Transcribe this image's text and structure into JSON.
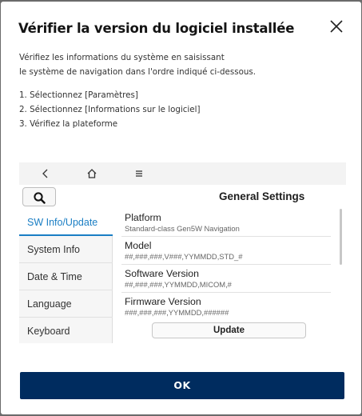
{
  "dialog": {
    "title": "Vérifier la version du logiciel installée",
    "description": [
      "Vérifiez les informations du système en saisissant",
      "le système de navigation dans l'ordre indiqué ci-dessous."
    ],
    "steps": [
      "1. Sélectionnez [Paramètres]",
      "2. Sélectionnez [Informations sur le logiciel]",
      "3. Vérifiez la plateforme"
    ],
    "ok_label": "OK",
    "close_icon": "close-icon"
  },
  "device_screen": {
    "top_icons": [
      "back-arrow-icon",
      "home-icon",
      "menu-icon"
    ],
    "search_icon": "search-icon",
    "title": "General Settings",
    "sidebar": [
      {
        "label": "SW Info/Update",
        "active": true
      },
      {
        "label": "System Info",
        "active": false
      },
      {
        "label": "Date & Time",
        "active": false
      },
      {
        "label": "Language",
        "active": false
      },
      {
        "label": "Keyboard",
        "active": false
      }
    ],
    "details": [
      {
        "label": "Platform",
        "value": "Standard-class Gen5W Navigation"
      },
      {
        "label": "Model",
        "value": "##,###,###,V###,YYMMDD,STD_#"
      },
      {
        "label": "Software Version",
        "value": "##,###,###,YYMMDD,MICOM,#"
      },
      {
        "label": "Firmware Version",
        "value": "###,###,###,YYMMDD,######"
      }
    ],
    "update_label": "Update",
    "accent_color": "#1a7ec4"
  },
  "colors": {
    "primary_button": "#002c5f",
    "overlay": "#6b6b6b"
  }
}
